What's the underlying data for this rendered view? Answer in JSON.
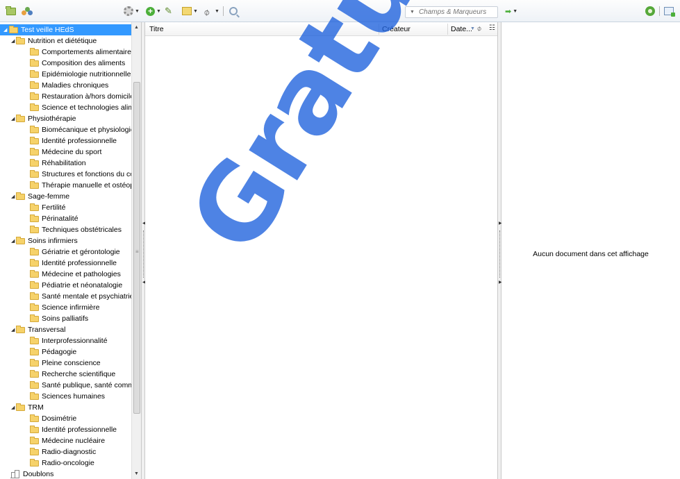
{
  "toolbar": {
    "search_placeholder": "Champs & Marqueurs"
  },
  "tree": {
    "root": "Test veille HEdS",
    "groups": [
      {
        "name": "Nutrition et diététique",
        "items": [
          "Comportements alimentaires",
          "Composition des aliments",
          "Epidémiologie nutritionnelle",
          "Maladies chroniques",
          "Restauration à/hors domicile",
          "Science et technologies alim..."
        ]
      },
      {
        "name": "Physiothérapie",
        "items": [
          "Biomécanique et physiologie",
          "Identité professionnelle",
          "Médecine du sport",
          "Réhabilitation",
          "Structures et fonctions du co...",
          "Thérapie manuelle et ostéop..."
        ]
      },
      {
        "name": "Sage-femme",
        "items": [
          "Fertilité",
          "Périnatalité",
          "Techniques obstétricales"
        ]
      },
      {
        "name": "Soins infirmiers",
        "items": [
          "Gériatrie et gérontologie",
          "Identité professionnelle",
          "Médecine et pathologies",
          "Pédiatrie et néonatalogie",
          "Santé mentale et psychiatrie",
          "Science infirmière",
          "Soins palliatifs"
        ]
      },
      {
        "name": "Transversal",
        "items": [
          "Interprofessionnalité",
          "Pédagogie",
          "Pleine conscience",
          "Recherche scientifique",
          "Santé publique, santé comm...",
          "Sciences humaines"
        ]
      },
      {
        "name": "TRM",
        "items": [
          "Dosimétrie",
          "Identité professionnelle",
          "Médecine nucléaire",
          "Radio-diagnostic",
          "Radio-oncologie"
        ]
      }
    ],
    "duplicates": "Doublons"
  },
  "columns": {
    "title": "Titre",
    "creator": "Créateur",
    "date": "Date..."
  },
  "right_pane": {
    "empty_message": "Aucun document dans cet affichage"
  },
  "watermark": "Gratuit.co"
}
